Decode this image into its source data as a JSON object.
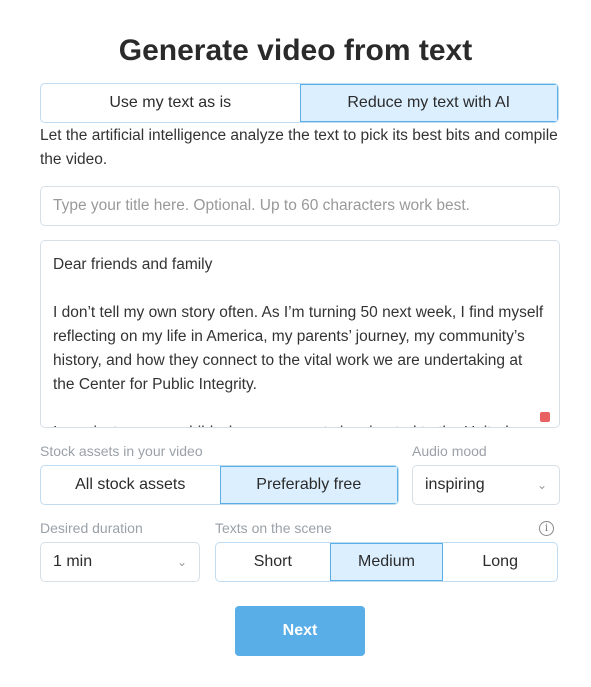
{
  "title": "Generate video from text",
  "mode_tabs": [
    {
      "label": "Use my text as is",
      "active": false
    },
    {
      "label": "Reduce my text with AI",
      "active": true
    }
  ],
  "description": "Let the artificial intelligence analyze the text to pick its best bits and compile the video.",
  "title_input": {
    "placeholder": "Type your title here. Optional. Up to 60 characters work best.",
    "value": ""
  },
  "body_text": "Dear friends and family\n\nI don’t tell my own story often. As I’m turning 50 next week, I find myself reflecting on my life in America, my parents’ journey, my community’s history, and how they connect to the vital work we are undertaking at the Center for Public Integrity.\n\nI was just a young child when my parents immigrated to the United",
  "stock": {
    "label": "Stock assets in your video",
    "options": [
      {
        "label": "All stock assets",
        "active": false
      },
      {
        "label": "Preferably free",
        "active": true
      }
    ]
  },
  "audio": {
    "label": "Audio mood",
    "value": "inspiring"
  },
  "duration": {
    "label": "Desired duration",
    "value": "1 min"
  },
  "texts": {
    "label": "Texts on the scene",
    "options": [
      {
        "label": "Short",
        "active": false
      },
      {
        "label": "Medium",
        "active": true
      },
      {
        "label": "Long",
        "active": false
      }
    ]
  },
  "next_label": "Next",
  "colors": {
    "accent": "#5aaee8",
    "active_bg": "#dcefff",
    "warning_dot": "#e86060"
  }
}
